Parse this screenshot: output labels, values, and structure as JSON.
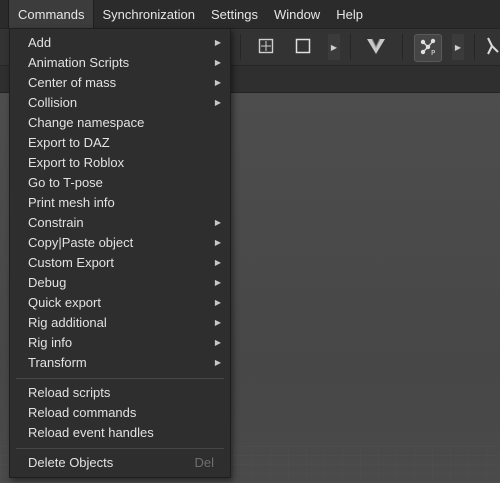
{
  "menubar": {
    "items": [
      {
        "label": "Commands",
        "active": true
      },
      {
        "label": "Synchronization"
      },
      {
        "label": "Settings"
      },
      {
        "label": "Window"
      },
      {
        "label": "Help"
      }
    ]
  },
  "toolbar": {
    "icons": [
      "select-box-icon",
      "square-icon",
      "chevron-right-icon",
      "v-logo-icon",
      "node-graph-icon",
      "chevron-right-icon",
      "pose-figure-icon"
    ]
  },
  "commands_menu": {
    "items": [
      {
        "label": "Add",
        "submenu": true
      },
      {
        "label": "Animation Scripts",
        "submenu": true
      },
      {
        "label": "Center of mass",
        "submenu": true
      },
      {
        "label": "Collision",
        "submenu": true
      },
      {
        "label": "Change namespace"
      },
      {
        "label": "Export to DAZ"
      },
      {
        "label": "Export to Roblox"
      },
      {
        "label": "Go to T-pose"
      },
      {
        "label": "Print mesh info"
      },
      {
        "label": "Constrain",
        "submenu": true
      },
      {
        "label": "Copy|Paste object",
        "submenu": true
      },
      {
        "label": "Custom Export",
        "submenu": true
      },
      {
        "label": "Debug",
        "submenu": true
      },
      {
        "label": "Quick export",
        "submenu": true
      },
      {
        "label": "Rig additional",
        "submenu": true
      },
      {
        "label": "Rig info",
        "submenu": true
      },
      {
        "label": "Transform",
        "submenu": true
      }
    ],
    "reload_items": [
      {
        "label": "Reload scripts"
      },
      {
        "label": "Reload commands"
      },
      {
        "label": "Reload event handles"
      }
    ],
    "delete_item": {
      "label": "Delete Objects",
      "shortcut": "Del"
    }
  },
  "colors": {
    "menu_bg": "#2e2e2e",
    "menubar_bg": "#2b2b2b",
    "viewport_bg": "#4a4a4a",
    "text": "#e2e2e2",
    "shortcut_text": "#6f6f6f"
  }
}
